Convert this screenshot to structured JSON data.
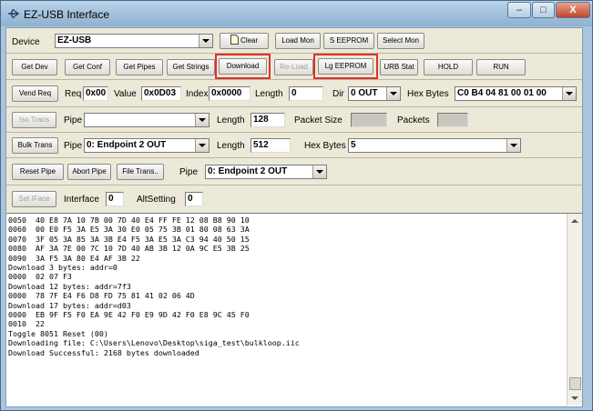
{
  "window": {
    "title": "EZ-USB Interface",
    "minimize": "–",
    "maximize": "□",
    "close": "X"
  },
  "row1": {
    "device_label": "Device",
    "device_value": "EZ-USB",
    "clear": "Clear",
    "load_mon": "Load Mon",
    "s_eeprom": "S EEPROM",
    "select_mon": "Select Mon"
  },
  "row2": {
    "get_dev": "Get Dev",
    "get_conf": "Get Conf",
    "get_pipes": "Get Pipes",
    "get_strings": "Get Strings",
    "download": "Download",
    "re_load": "Re-Load",
    "lg_eeprom": "Lg EEPROM",
    "urb_stat": "URB Stat",
    "hold": "HOLD",
    "run": "RUN"
  },
  "row3": {
    "vend_req": "Vend Req",
    "req_label": "Req",
    "req_value": "0x00",
    "value_label": "Value",
    "value_value": "0x0D03",
    "index_label": "Index",
    "index_value": "0x0000",
    "length_label": "Length",
    "length_value": "0",
    "dir_label": "Dir",
    "dir_value": "0 OUT",
    "hex_label": "Hex Bytes",
    "hex_value": "C0 B4 04 81 00 01 00"
  },
  "row4": {
    "iso_trans": "Iso Trans",
    "pipe_label": "Pipe",
    "pipe_value": "",
    "length_label": "Length",
    "length_value": "128",
    "packet_size_label": "Packet Size",
    "packets_label": "Packets"
  },
  "row5": {
    "bulk_trans": "Bulk Trans",
    "pipe_label": "Pipe",
    "pipe_value": "0: Endpoint 2 OUT",
    "length_label": "Length",
    "length_value": "512",
    "hex_label": "Hex Bytes",
    "hex_value": "5"
  },
  "row6": {
    "reset_pipe": "Reset Pipe",
    "abort_pipe": "Abort Pipe",
    "file_trans": "File Trans..",
    "pipe_label": "Pipe",
    "pipe_value": "0: Endpoint 2 OUT"
  },
  "row7": {
    "set_iface": "Set IFace",
    "interface_label": "Interface",
    "interface_value": "0",
    "altsetting_label": "AltSetting",
    "altsetting_value": "0"
  },
  "log": {
    "text": "0050  40 E8 7A 10 7B 00 7D 40 E4 FF FE 12 08 B8 90 10\n0060  00 E0 F5 3A E5 3A 30 E0 05 75 3B 01 80 08 63 3A\n0070  3F 05 3A 85 3A 3B E4 F5 3A E5 3A C3 94 40 50 15\n0080  AF 3A 7E 00 7C 10 7D 40 AB 3B 12 0A 9C E5 3B 25\n0090  3A F5 3A 80 E4 AF 3B 22\nDownload 3 bytes: addr=0\n0000  02 07 F3\nDownload 12 bytes: addr=7f3\n0000  78 7F E4 F6 D8 FD 75 81 41 02 06 4D\nDownload 17 bytes: addr=d03\n0000  EB 9F F5 F0 EA 9E 42 F0 E9 9D 42 F0 E8 9C 45 F0\n0010  22\nToggle 8051 Reset (00)\nDownloading file: C:\\Users\\Lenovo\\Desktop\\siga_test\\bulkloop.iic\nDownload Successful: 2168 bytes downloaded"
  },
  "colors": {
    "highlight": "#e0302a",
    "title_bar": "#a9c4dd",
    "panel": "#ece9d8"
  }
}
